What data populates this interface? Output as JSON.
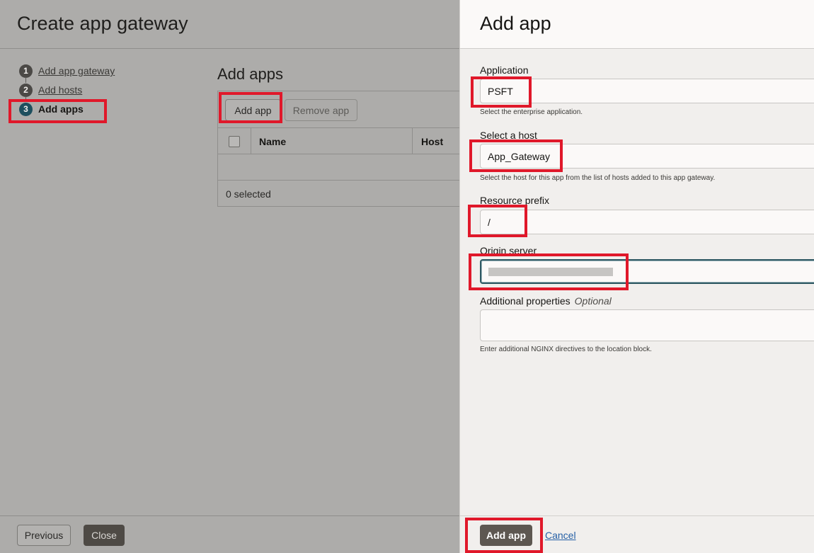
{
  "wizard": {
    "title": "Create app gateway",
    "steps": [
      {
        "number": "1",
        "label": "Add app gateway"
      },
      {
        "number": "2",
        "label": "Add hosts"
      },
      {
        "number": "3",
        "label": "Add apps"
      }
    ],
    "section_title": "Add apps",
    "toolbar": {
      "add_label": "Add app",
      "remove_label": "Remove app"
    },
    "table": {
      "columns": [
        "Name",
        "Host"
      ],
      "rows": [],
      "selected_text": "0 selected"
    },
    "footer": {
      "previous_label": "Previous",
      "close_label": "Close"
    }
  },
  "drawer": {
    "title": "Add app",
    "fields": {
      "application": {
        "label": "Application",
        "value": "PSFT",
        "help": "Select the enterprise application."
      },
      "host": {
        "label": "Select a host",
        "value": "App_Gateway",
        "help": "Select the host for this app from the list of hosts added to this app gateway."
      },
      "prefix": {
        "label": "Resource prefix",
        "value": "/"
      },
      "origin": {
        "label": "Origin server",
        "value": ""
      },
      "additional": {
        "label": "Additional properties",
        "optional": "Optional",
        "value": "",
        "help": "Enter additional NGINX directives to the location block."
      }
    },
    "footer": {
      "submit_label": "Add app",
      "cancel_label": "Cancel"
    }
  },
  "colors": {
    "highlight": "#e0182a",
    "current_step": "#1d4f5e",
    "link": "#2660a6"
  }
}
